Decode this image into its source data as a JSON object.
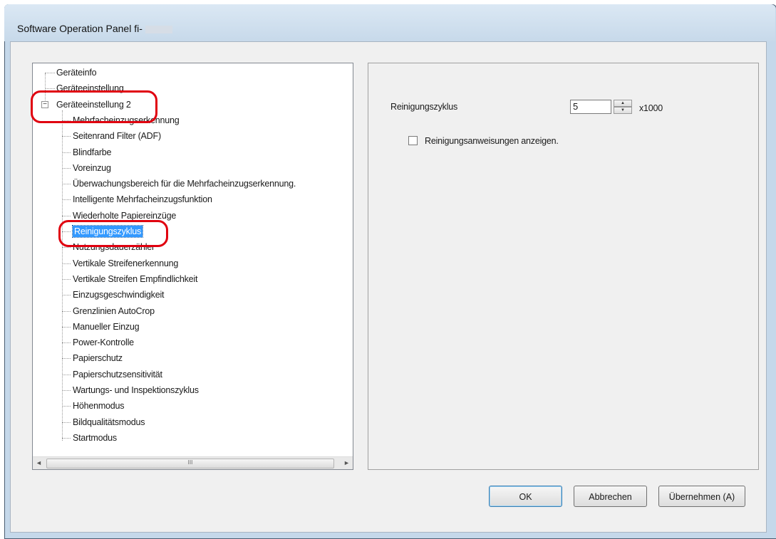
{
  "window": {
    "title": "Software Operation Panel fi-"
  },
  "tree": {
    "items": [
      "Geräteinfo",
      "Geräteeinstellung",
      "Geräteeinstellung 2",
      "Mehrfacheinzugserkennung",
      "Seitenrand Filter (ADF)",
      "Blindfarbe",
      "Voreinzug",
      "Überwachungsbereich für die Mehrfacheinzugserkennung.",
      "Intelligente Mehrfacheinzugsfunktion",
      "Wiederholte Papiereinzüge",
      "Reinigungszyklus",
      "Nutzungsdauerzähler",
      "Vertikale Streifenerkennung",
      "Vertikale Streifen Empfindlichkeit",
      "Einzugsgeschwindigkeit",
      "Grenzlinien AutoCrop",
      "Manueller Einzug",
      "Power-Kontrolle",
      "Papierschutz",
      "Papierschutzsensitivität",
      "Wartungs- und Inspektionszyklus",
      "Höhenmodus",
      "Bildqualitätsmodus",
      "Startmodus"
    ],
    "expander_symbol": "−",
    "selected": "Reinigungszyklus",
    "scroll_thumb_grip": "III",
    "scroll_left": "◄",
    "scroll_right": "►"
  },
  "settings": {
    "cycle_label": "Reinigungszyklus",
    "cycle_value": "5",
    "cycle_unit": "x1000",
    "show_instructions_label": "Reinigungsanweisungen anzeigen.",
    "show_instructions_checked": false,
    "spin_up": "▲",
    "spin_down": "▼"
  },
  "buttons": {
    "ok": "OK",
    "cancel": "Abbrechen",
    "apply": "Übernehmen (A)"
  },
  "colors": {
    "selection": "#3399ff",
    "annotation": "#e0000f"
  }
}
